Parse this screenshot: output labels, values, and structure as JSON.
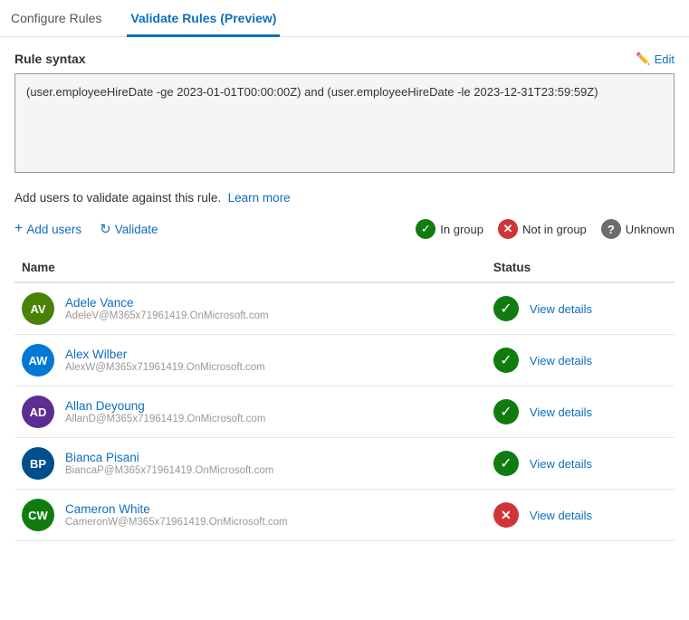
{
  "tabs": [
    {
      "id": "configure",
      "label": "Configure Rules",
      "active": false
    },
    {
      "id": "validate",
      "label": "Validate Rules (Preview)",
      "active": true
    }
  ],
  "rule_syntax": {
    "label": "Rule syntax",
    "edit_label": "Edit",
    "value": "(user.employeeHireDate -ge 2023-01-01T00:00:00Z) and (user.employeeHireDate -le 2023-12-31T23:59:59Z)"
  },
  "info_bar": {
    "text": "Add users to validate against this rule.",
    "learn_more_label": "Learn more"
  },
  "toolbar": {
    "add_users_label": "Add users",
    "validate_label": "Validate",
    "legend": {
      "in_group_label": "In group",
      "not_in_group_label": "Not in group",
      "unknown_label": "Unknown"
    }
  },
  "table": {
    "columns": [
      "Name",
      "Status"
    ],
    "rows": [
      {
        "id": "adele-vance",
        "initials": "AV",
        "avatar_color": "#498205",
        "name": "Adele Vance",
        "email": "AdeleV@M365x71961419.OnMicrosoft.com",
        "status": "in_group",
        "view_details_label": "View details"
      },
      {
        "id": "alex-wilber",
        "initials": "AW",
        "avatar_color": "#0078d4",
        "name": "Alex Wilber",
        "email": "AlexW@M365x71961419.OnMicrosoft.com",
        "status": "in_group",
        "view_details_label": "View details"
      },
      {
        "id": "allan-deyoung",
        "initials": "AD",
        "avatar_color": "#5c2e91",
        "name": "Allan Deyoung",
        "email": "AllanD@M365x71961419.OnMicrosoft.com",
        "status": "in_group",
        "view_details_label": "View details"
      },
      {
        "id": "bianca-pisani",
        "initials": "BP",
        "avatar_color": "#004e8c",
        "name": "Bianca Pisani",
        "email": "BiancaP@M365x71961419.OnMicrosoft.com",
        "status": "in_group",
        "view_details_label": "View details"
      },
      {
        "id": "cameron-white",
        "initials": "CW",
        "avatar_color": "#107c10",
        "name": "Cameron White",
        "email": "CameronW@M365x71961419.OnMicrosoft.com",
        "status": "not_in_group",
        "view_details_label": "View details"
      }
    ]
  }
}
